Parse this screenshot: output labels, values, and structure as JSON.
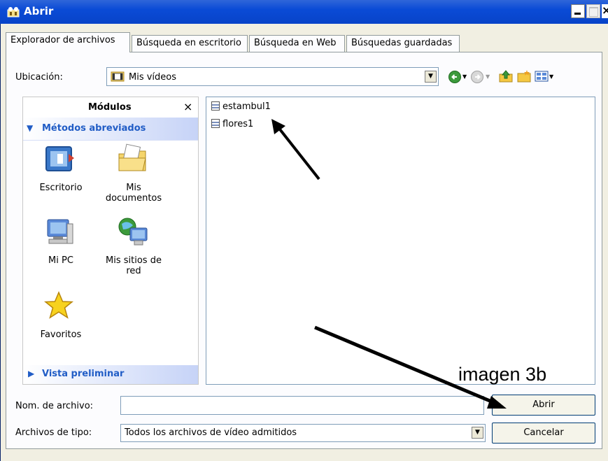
{
  "window": {
    "title": "Abrir"
  },
  "tabs": [
    {
      "label": "Explorador de archivos",
      "active": true
    },
    {
      "label": "Búsqueda en escritorio",
      "active": false
    },
    {
      "label": "Búsqueda en Web",
      "active": false
    },
    {
      "label": "Búsquedas guardadas",
      "active": false
    }
  ],
  "location": {
    "label": "Ubicación:",
    "value": "Mis vídeos"
  },
  "modules": {
    "title": "Módulos",
    "close": "×",
    "shortcuts_header": "Métodos abreviados",
    "shortcuts": [
      {
        "label": "Escritorio",
        "icon": "desktop-icon"
      },
      {
        "label": "Mis documentos",
        "icon": "my-documents-icon"
      },
      {
        "label": "Mi PC",
        "icon": "my-computer-icon"
      },
      {
        "label": "Mis sitios de red",
        "icon": "network-places-icon"
      },
      {
        "label": "Favoritos",
        "icon": "favorites-star-icon"
      }
    ],
    "preview_header": "Vista preliminar"
  },
  "files": [
    "estambul1",
    "flores1"
  ],
  "filename": {
    "label": "Nom. de archivo:",
    "value": ""
  },
  "filetype": {
    "label": "Archivos de tipo:",
    "value": "Todos los archivos de vídeo admitidos"
  },
  "buttons": {
    "open": "Abrir",
    "cancel": "Cancelar"
  },
  "annotation": "imagen 3b"
}
